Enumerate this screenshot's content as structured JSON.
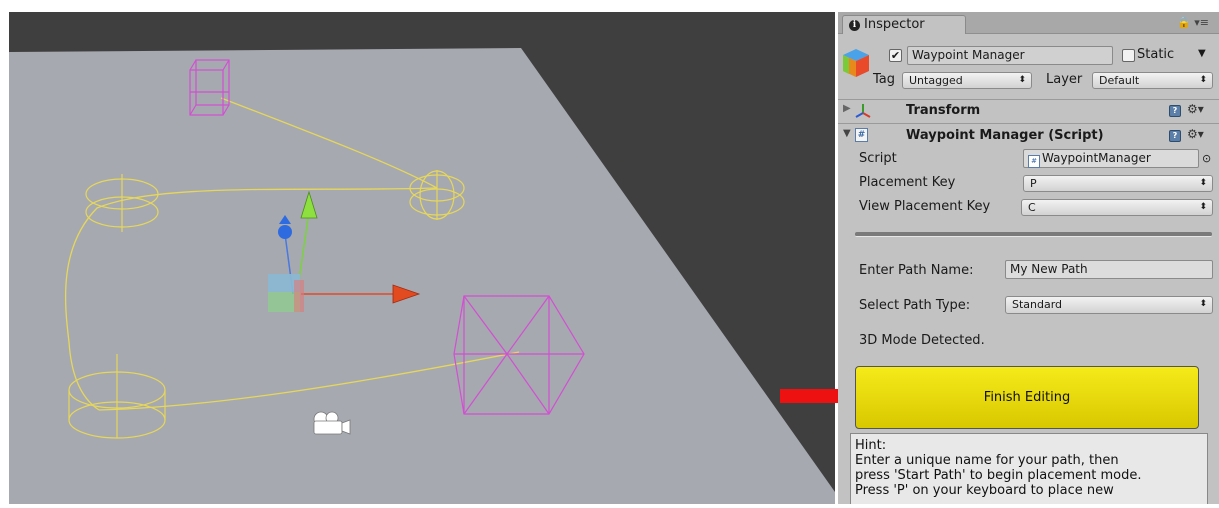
{
  "inspector": {
    "tab_label": "Inspector",
    "object_name": "Waypoint Manager",
    "object_active": true,
    "static_label": "Static",
    "tag_label": "Tag",
    "tag_value": "Untagged",
    "layer_label": "Layer",
    "layer_value": "Default"
  },
  "components": {
    "transform_label": "Transform",
    "script_title": "Waypoint Manager (Script)"
  },
  "script_fields": {
    "script_label": "Script",
    "script_value": "WaypointManager",
    "placement_key_label": "Placement Key",
    "placement_key_value": "P",
    "view_key_label": "View Placement Key",
    "view_key_value": "C"
  },
  "path": {
    "name_label": "Enter Path Name:",
    "name_value": "My New Path",
    "type_label": "Select Path Type:",
    "type_value": "Standard",
    "mode_text": "3D Mode Detected.",
    "finish_label": "Finish Editing"
  },
  "hint": {
    "title": "Hint:",
    "line1": "Enter a unique name for your path, then",
    "line2": "press 'Start Path' to begin placement mode.",
    "line3": "Press 'P' on your keyboard to place new"
  },
  "colors": {
    "scene_background": "#3f3f3f",
    "ground_plane": "#a6a9b0",
    "path_line": "#e6d75a",
    "waypoint_box": "#d24fd2",
    "finish_button": "#e8da0a",
    "arrow": "#ee1111"
  }
}
